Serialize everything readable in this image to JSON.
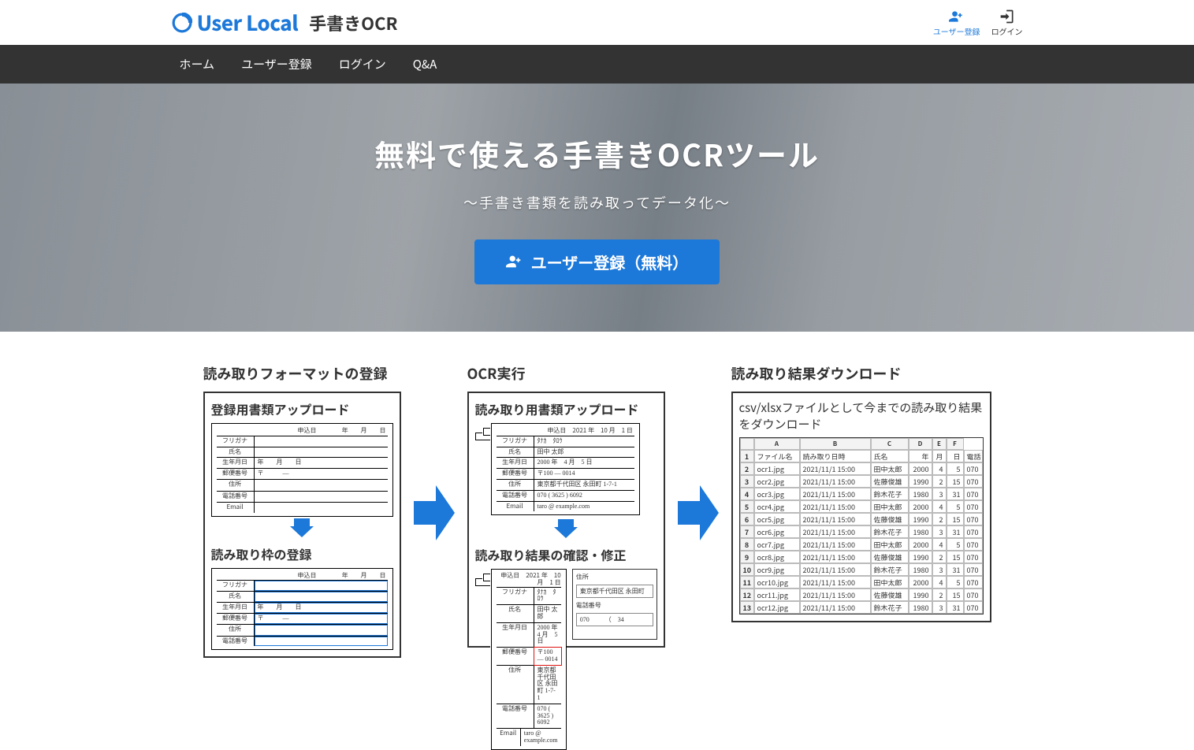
{
  "brand": {
    "name": "User Local",
    "product": "手書きOCR"
  },
  "auth": {
    "register": "ユーザー登録",
    "login": "ログイン"
  },
  "nav": {
    "home": "ホーム",
    "register": "ユーザー登録",
    "login": "ログイン",
    "qa": "Q&A"
  },
  "hero": {
    "title": "無料で使える手書きOCRツール",
    "subtitle": "〜手書き書類を読み取ってデータ化〜",
    "cta": "ユーザー登録（無料）"
  },
  "flow": {
    "col1": {
      "heading": "読み取りフォーマットの登録",
      "panel1_title": "登録用書類アップロード",
      "panel2_title": "読み取り枠の登録",
      "form_labels": {
        "header_right": "申込日　　　　年　　月　　日",
        "furigana": "フリガナ",
        "name": "氏名",
        "birth": "生年月日",
        "birth_val": "年　　月　　日",
        "zip": "郵便番号",
        "zip_val": "〒　　　―",
        "addr": "住所",
        "tel": "電話番号",
        "email": "Email"
      }
    },
    "col2": {
      "heading": "OCR実行",
      "panel1_title": "読み取り用書類アップロード",
      "panel2_title": "読み取り結果の確認・修正",
      "filled": {
        "header_right": "申込日　2021 年　10 月　1 日",
        "furigana": "ﾀﾅｶ　ﾀﾛｳ",
        "name": "田中 太郎",
        "birth": "2000 年　4 月　5 日",
        "zip": "〒100 ― 0014",
        "addr": "東京都千代田区 永田町 1-7-1",
        "tel": "070 ( 3625 ) 6092",
        "email": "taro @ example.com"
      },
      "side": {
        "addr_label": "住所",
        "addr_val": "東京都千代田区 永田町",
        "tel_label": "電話番号",
        "tel_val": "070　　　（　34"
      }
    },
    "col3": {
      "heading": "読み取り結果ダウンロード",
      "sub": "csv/xlsxファイルとして今までの読み取り結果をダウンロード",
      "columns": {
        "A": "A",
        "B": "B",
        "C": "C",
        "D": "D",
        "E": "E",
        "F": "F"
      },
      "headers": {
        "file": "ファイル名",
        "datetime": "読み取り日時",
        "name": "氏名",
        "year": "年",
        "month": "月",
        "day": "日",
        "tel": "電話"
      },
      "rows": [
        {
          "i": "2",
          "file": "ocr1.jpg",
          "dt": "2021/11/1 15:00",
          "name": "田中太郎",
          "y": "2000",
          "m": "4",
          "d": "5",
          "t": "070"
        },
        {
          "i": "3",
          "file": "ocr2.jpg",
          "dt": "2021/11/1 15:00",
          "name": "佐藤俊雄",
          "y": "1990",
          "m": "2",
          "d": "15",
          "t": "070"
        },
        {
          "i": "4",
          "file": "ocr3.jpg",
          "dt": "2021/11/1 15:00",
          "name": "鈴木花子",
          "y": "1980",
          "m": "3",
          "d": "31",
          "t": "070"
        },
        {
          "i": "5",
          "file": "ocr4.jpg",
          "dt": "2021/11/1 15:00",
          "name": "田中太郎",
          "y": "2000",
          "m": "4",
          "d": "5",
          "t": "070"
        },
        {
          "i": "6",
          "file": "ocr5.jpg",
          "dt": "2021/11/1 15:00",
          "name": "佐藤俊雄",
          "y": "1990",
          "m": "2",
          "d": "15",
          "t": "070"
        },
        {
          "i": "7",
          "file": "ocr6.jpg",
          "dt": "2021/11/1 15:00",
          "name": "鈴木花子",
          "y": "1980",
          "m": "3",
          "d": "31",
          "t": "070"
        },
        {
          "i": "8",
          "file": "ocr7.jpg",
          "dt": "2021/11/1 15:00",
          "name": "田中太郎",
          "y": "2000",
          "m": "4",
          "d": "5",
          "t": "070"
        },
        {
          "i": "9",
          "file": "ocr8.jpg",
          "dt": "2021/11/1 15:00",
          "name": "佐藤俊雄",
          "y": "1990",
          "m": "2",
          "d": "15",
          "t": "070"
        },
        {
          "i": "10",
          "file": "ocr9.jpg",
          "dt": "2021/11/1 15:00",
          "name": "鈴木花子",
          "y": "1980",
          "m": "3",
          "d": "31",
          "t": "070"
        },
        {
          "i": "11",
          "file": "ocr10.jpg",
          "dt": "2021/11/1 15:00",
          "name": "田中太郎",
          "y": "2000",
          "m": "4",
          "d": "5",
          "t": "070"
        },
        {
          "i": "12",
          "file": "ocr11.jpg",
          "dt": "2021/11/1 15:00",
          "name": "佐藤俊雄",
          "y": "1990",
          "m": "2",
          "d": "15",
          "t": "070"
        },
        {
          "i": "13",
          "file": "ocr12.jpg",
          "dt": "2021/11/1 15:00",
          "name": "鈴木花子",
          "y": "1980",
          "m": "3",
          "d": "31",
          "t": "070"
        }
      ]
    }
  }
}
